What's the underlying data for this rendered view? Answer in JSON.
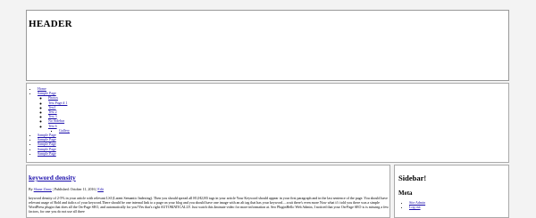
{
  "header": {
    "title": "HEADER"
  },
  "nav": {
    "items": [
      {
        "label": "Home"
      },
      {
        "label": "Sample Page"
      }
    ],
    "sub_items": [
      {
        "label": "Photos"
      },
      {
        "label": "Test Page # 1"
      },
      {
        "label": "Test1"
      },
      {
        "label": "Test 2"
      },
      {
        "label": "Test 3"
      },
      {
        "label": "No Sidebar"
      },
      {
        "label": "Test 6"
      }
    ],
    "sub_sub_items": [
      {
        "label": "Gallery"
      }
    ],
    "more_items": [
      {
        "label": "Sample Page"
      },
      {
        "label": "Sample Page"
      },
      {
        "label": "Sample Page"
      },
      {
        "label": "Sample Page"
      },
      {
        "label": "Sample Page"
      }
    ]
  },
  "post": {
    "title": "keyword density",
    "meta_by": "By",
    "author": "Shane Zinny",
    "meta_published": "| Published: October 11, 2016 |",
    "edit": "Edit",
    "excerpt": "keyword density of 2-5% in your article with relevant LSI (Latent Semantic Indexing). Then you should spread all H1,H2,H3 tags in your article Your Keyword should appear in your first paragraph and in the last sentence of the page. You should have relevant usage of Bold and italics of your keyword.There should be one internal link to a page on your blog and you should have one image with an alt tag that has your keyword.....wait there's even more Now what if i told you there was a simple WordPress plugin that does all the On-Page SEO, and automatically for you?Yes that's right AUTOMATICALLY. Just watch this 4minute video for more information at. Seo PluginHello Web Admin, I noticed that your On-Page SEO is is missing a few factors, for one you do not use all three"
  },
  "sidebar": {
    "title": "Sidebar!",
    "meta_title": "Meta",
    "links": [
      {
        "label": "Site Admin"
      },
      {
        "label": "Log out"
      }
    ]
  }
}
